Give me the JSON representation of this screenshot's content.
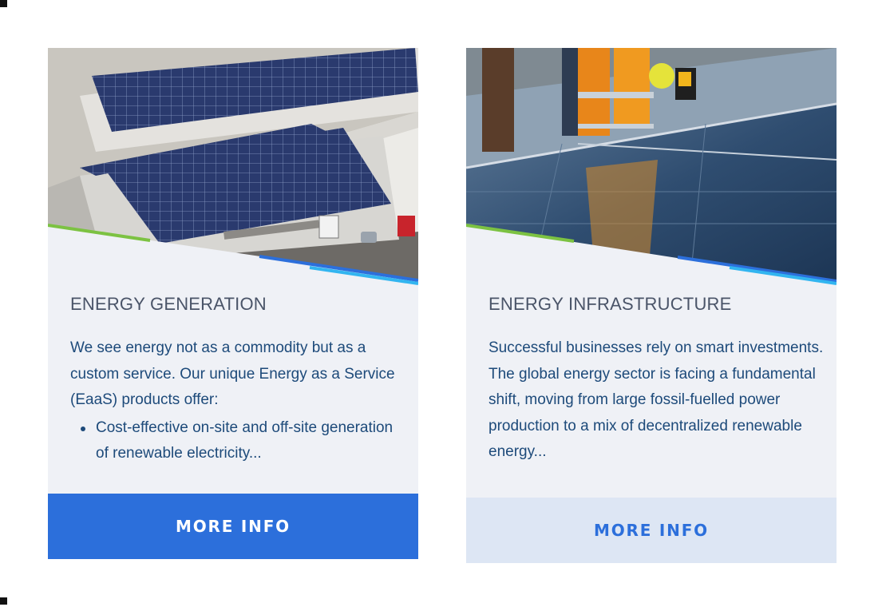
{
  "cards": [
    {
      "title": "ENERGY GENERATION",
      "intro": "We see energy not as a commodity but as a custom service. Our unique Energy as a Service (EaaS) products offer:",
      "bullets": [
        "Cost-effective on-site and off-site generation of renewable electricity..."
      ],
      "button_label": "MORE INFO"
    },
    {
      "title": "ENERGY INFRASTRUCTURE",
      "intro": "Successful businesses rely on smart investments. The global energy sector is facing a fundamental shift, moving from large fossil-fuelled power production to a mix of decentralized renewable energy...",
      "button_label": "MORE INFO"
    }
  ],
  "colors": {
    "card_background": "#eff1f6",
    "primary_button": "#2c6fdb",
    "secondary_button": "#dde6f4",
    "accent_green": "#7cc242",
    "accent_blue": "#2c6fdb",
    "accent_cyan": "#32b5f0"
  }
}
